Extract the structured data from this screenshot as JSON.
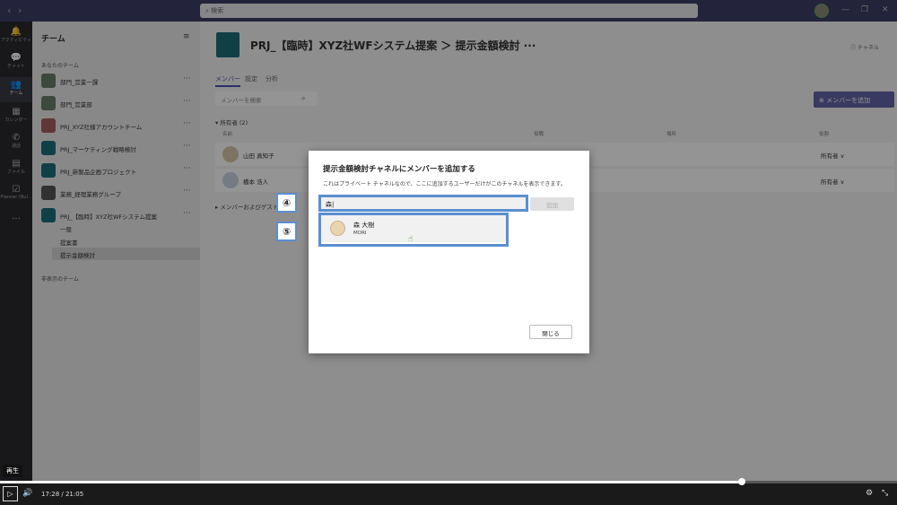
{
  "titlebar": {
    "search_placeholder": "検索",
    "back": "‹",
    "forward": "›",
    "minimize": "—",
    "maximize": "❐",
    "close": "✕"
  },
  "rail": [
    {
      "label": "アクティビティ",
      "icon": "bell-icon",
      "glyph": "🔔"
    },
    {
      "label": "チャット",
      "icon": "chat-icon",
      "glyph": "💬"
    },
    {
      "label": "チーム",
      "icon": "teams-icon",
      "glyph": "👥"
    },
    {
      "label": "カレンダー",
      "icon": "calendar-icon",
      "glyph": "▦"
    },
    {
      "label": "通話",
      "icon": "phone-icon",
      "glyph": "✆"
    },
    {
      "label": "ファイル",
      "icon": "files-icon",
      "glyph": "▤"
    },
    {
      "label": "Planner (Bul...",
      "icon": "planner-icon",
      "glyph": "☑"
    },
    {
      "label": "",
      "icon": "more-icon",
      "glyph": "…"
    }
  ],
  "teams_panel": {
    "title": "チーム",
    "section_yours": "あなたのチーム",
    "teams": [
      {
        "name": "部門_営業一課"
      },
      {
        "name": "部門_営業部"
      },
      {
        "name": "PRJ_XYZ社様アカウントチーム"
      },
      {
        "name": "PRJ_マーケティング戦略検討"
      },
      {
        "name": "PRJ_新製品企画プロジェクト"
      },
      {
        "name": "業務_経理業務グループ"
      },
      {
        "name": "PRJ_【臨時】XYZ社WFシステム提案"
      }
    ],
    "channels": [
      "一般",
      "提案書",
      "提示金額検討"
    ],
    "section_hidden": "非表示のチーム"
  },
  "main": {
    "breadcrumb": "PRJ_【臨時】XYZ社WFシステム提案 ＞ 提示金額検討 ···",
    "team_button": "ⓘ チャネル",
    "tabs": [
      "メンバー",
      "設定",
      "分析"
    ],
    "member_search_placeholder": "メンバーを検索",
    "add_member": "⊕ メンバーを追加",
    "owners_heading": "▾ 所有者 (2)",
    "columns": [
      "名前",
      "役職",
      "場所",
      "役割"
    ],
    "members": [
      {
        "name": "山田 真知子",
        "role": "所有者 ∨"
      },
      {
        "name": "橋本 浩人",
        "role": "所有者 ∨"
      }
    ],
    "guests_heading": "▸ メンバーおよびゲスト"
  },
  "dialog": {
    "title": "提示金額検討チャネルにメンバーを追加する",
    "description": "これはプライベート チャネルなので、ここに追加するユーザーだけがこのチャネルを表示できます。",
    "input_value": "森|",
    "add_button": "追加",
    "suggestion": {
      "name": "森 大樹",
      "sub": "MORI"
    },
    "close_button": "閉じる"
  },
  "callouts": {
    "step4": "④",
    "step5": "⑤"
  },
  "player": {
    "tooltip": "再生",
    "time": "17:28 / 21:05",
    "progress": 0.827
  }
}
